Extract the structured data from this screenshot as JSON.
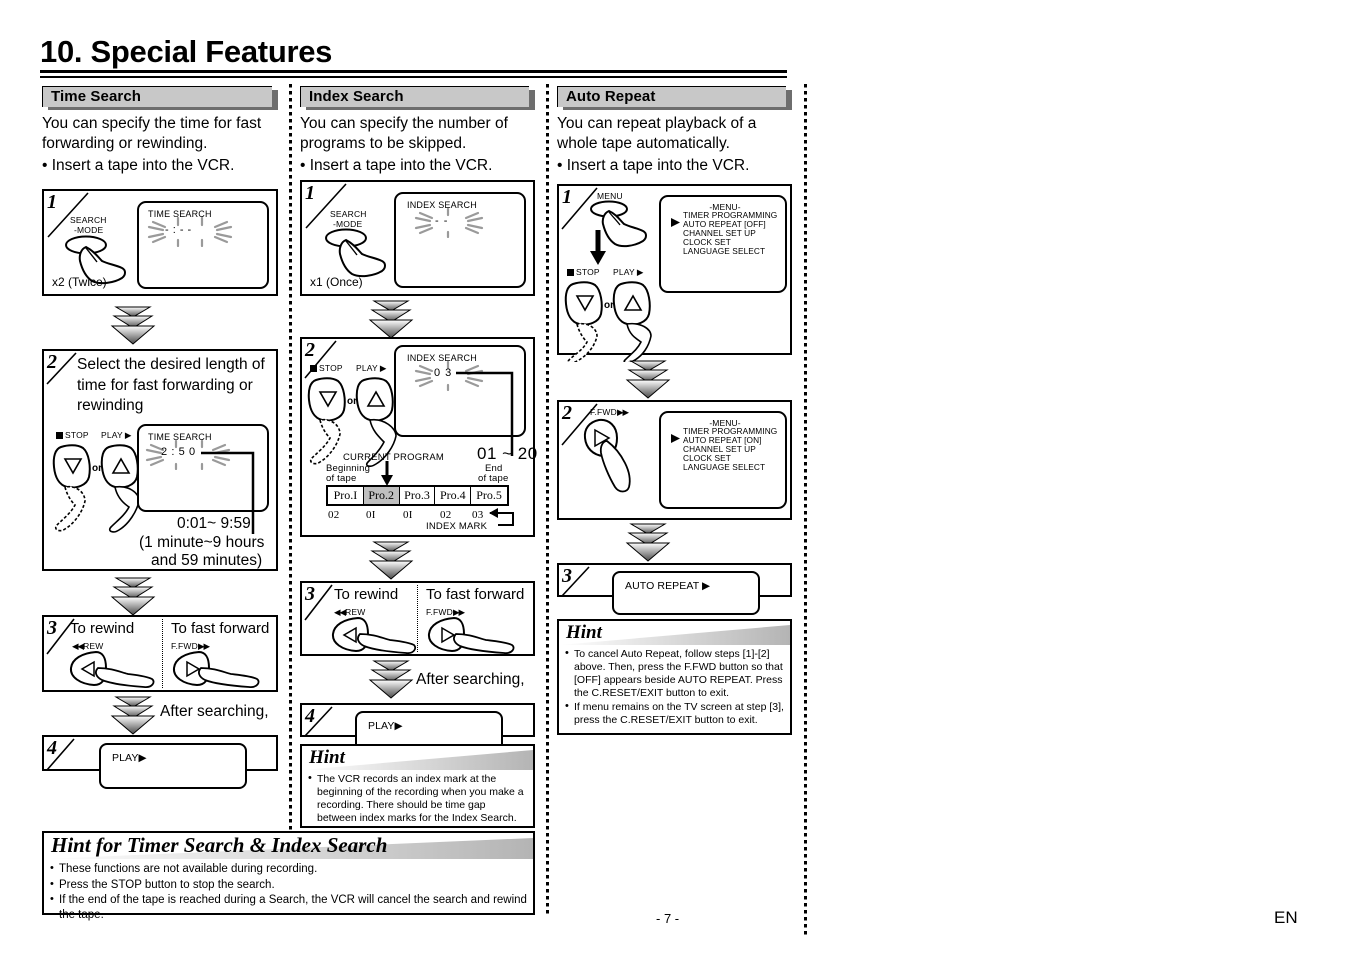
{
  "page": {
    "title": "10. Special Features",
    "page_number": "- 7 -",
    "language_mark": "EN"
  },
  "columns": [
    {
      "id": "time-search",
      "header": "Time Search",
      "intro": "You can specify the time for fast forwarding or rewinding.",
      "bullet": "• Insert a tape into the VCR.",
      "steps": [
        {
          "num": "1",
          "button_label": "SEARCH",
          "button_sub": "-MODE",
          "press_count": "x2 (Twice)",
          "osd_title": "TIME SEARCH",
          "osd_value": "- : - -"
        },
        {
          "num": "2",
          "instruction": "Select the desired length of time for fast forwarding or rewinding",
          "btn_left": "STOP",
          "btn_or": "or",
          "btn_right": "PLAY",
          "osd_title": "TIME SEARCH",
          "osd_value": "2 : 5 0",
          "range": "0:01~ 9:59",
          "range_note1": "(1 minute~9 hours",
          "range_note2": "and 59 minutes)"
        },
        {
          "num": "3",
          "left_title": "To rewind",
          "left_btn": "REW",
          "right_title": "To fast forward",
          "right_btn": "F.FWD"
        },
        {
          "num": "4",
          "after_label": "After searching,",
          "osd_value": "PLAY▶"
        }
      ]
    },
    {
      "id": "index-search",
      "header": "Index Search",
      "intro": "You can specify the number of programs to be skipped.",
      "bullet": "• Insert a tape into the VCR.",
      "steps": [
        {
          "num": "1",
          "button_label": "SEARCH",
          "button_sub": "-MODE",
          "press_count": "x1 (Once)",
          "osd_title": "INDEX SEARCH",
          "osd_value": "- -"
        },
        {
          "num": "2",
          "btn_left": "STOP",
          "btn_or": "or",
          "btn_right": "PLAY",
          "osd_title": "INDEX SEARCH",
          "osd_value": "0 3",
          "range": "01 ~ 20",
          "current_program": "CURRENT PROGRAM",
          "beginning_of_tape_1": "Beginning",
          "beginning_of_tape_2": "of tape",
          "end_of_tape_1": "End",
          "end_of_tape_2": "of tape",
          "index_mark": "INDEX MARK",
          "programs": [
            "Pro.I",
            "Pro.2",
            "Pro.3",
            "Pro.4",
            "Pro.5"
          ],
          "highlighted_program": "Pro.2",
          "marks": [
            "02",
            "0I",
            "0I",
            "02",
            "03"
          ]
        },
        {
          "num": "3",
          "left_title": "To rewind",
          "left_btn": "REW",
          "right_title": "To fast forward",
          "right_btn": "F.FWD"
        },
        {
          "num": "4",
          "after_label": "After searching,",
          "osd_value": "PLAY▶"
        }
      ],
      "hint": {
        "title": "Hint",
        "items": [
          "The VCR records an index mark at the beginning of the recording when you make a recording. There should be time gap between index marks for the Index Search."
        ]
      }
    },
    {
      "id": "auto-repeat",
      "header": "Auto Repeat",
      "intro": "You can repeat playback of a whole tape automatically.",
      "bullet": "• Insert a tape into the VCR.",
      "steps": [
        {
          "num": "1",
          "button_label": "MENU",
          "btn_left": "STOP",
          "btn_or": "or",
          "btn_right": "PLAY",
          "osd_title": "-MENU-",
          "menu_items": [
            "TIMER PROGRAMMING",
            "AUTO REPEAT  [OFF]",
            "CHANNEL SET UP",
            "CLOCK SET",
            "LANGUAGE SELECT"
          ],
          "cursor_index": 1
        },
        {
          "num": "2",
          "button_label": "F.FWD",
          "osd_title": "-MENU-",
          "menu_items": [
            "TIMER PROGRAMMING",
            "AUTO REPEAT  [ON]",
            "CHANNEL SET UP",
            "CLOCK SET",
            "LANGUAGE SELECT"
          ],
          "cursor_index": 1
        },
        {
          "num": "3",
          "osd_value": "AUTO REPEAT ▶"
        }
      ],
      "hint": {
        "title": "Hint",
        "items": [
          "To cancel Auto Repeat, follow steps [1]-[2] above.  Then, press the F.FWD button so that [OFF] appears beside AUTO REPEAT. Press the C.RESET/EXIT button to exit.",
          "If menu remains on the TV screen at step [3], press the C.RESET/EXIT button to exit."
        ]
      }
    }
  ],
  "bottom_hint": {
    "title": "Hint for Timer Search & Index Search",
    "items": [
      "These functions are not available during recording.",
      "Press the STOP button to stop the search.",
      "If the end of the tape is reached during a Search, the VCR will cancel the search and rewind the tape."
    ]
  },
  "colors": {
    "header_bar": "#c8c8c8",
    "header_shadow": "#6e6e6e",
    "highlight": "#bfbfbf"
  }
}
